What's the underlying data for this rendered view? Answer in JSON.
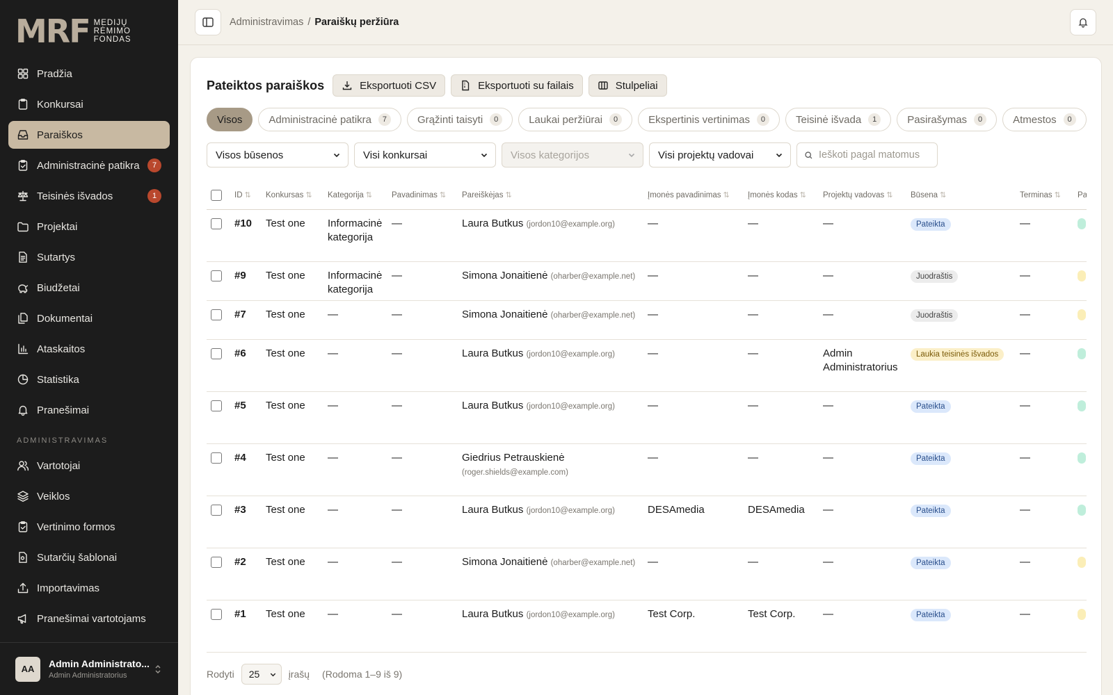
{
  "brand": {
    "mark": "MRF",
    "line1": "MEDIJŲ",
    "line2": "RĖMIMO",
    "line3": "FONDAS"
  },
  "nav": {
    "items": [
      {
        "label": "Pradžia",
        "icon": "dashboard-icon",
        "active": false
      },
      {
        "label": "Konkursai",
        "icon": "clipboard-icon",
        "active": false
      },
      {
        "label": "Paraiškos",
        "icon": "inbox-icon",
        "active": true
      },
      {
        "label": "Administracinė patikra",
        "icon": "clipboard-check-icon",
        "active": false,
        "count": "7"
      },
      {
        "label": "Teisinės išvados",
        "icon": "scale-icon",
        "active": false,
        "count": "1"
      },
      {
        "label": "Projektai",
        "icon": "folder-icon",
        "active": false
      },
      {
        "label": "Sutartys",
        "icon": "file-text-icon",
        "active": false
      },
      {
        "label": "Biudžetai",
        "icon": "piggy-bank-icon",
        "active": false
      },
      {
        "label": "Dokumentai",
        "icon": "files-icon",
        "active": false
      },
      {
        "label": "Ataskaitos",
        "icon": "bar-chart-icon",
        "active": false
      },
      {
        "label": "Statistika",
        "icon": "pie-chart-icon",
        "active": false
      },
      {
        "label": "Pranešimai",
        "icon": "bell-icon",
        "active": false
      }
    ],
    "section_label": "ADMINISTRAVIMAS",
    "admin_items": [
      {
        "label": "Vartotojai",
        "icon": "users-icon"
      },
      {
        "label": "Veiklos",
        "icon": "layers-icon"
      },
      {
        "label": "Vertinimo formos",
        "icon": "clipboard-check-icon"
      },
      {
        "label": "Sutarčių šablonai",
        "icon": "file-template-icon"
      },
      {
        "label": "Importavimas",
        "icon": "upload-icon"
      },
      {
        "label": "Pranešimai vartotojams",
        "icon": "megaphone-icon"
      }
    ]
  },
  "user": {
    "initials": "AA",
    "name": "Admin Administrato...",
    "role": "Admin Administratorius"
  },
  "breadcrumb": {
    "parent": "Administravimas",
    "separator": "/",
    "current": "Paraiškų peržiūra"
  },
  "card": {
    "title": "Pateiktos paraiškos",
    "export_csv": "Eksportuoti CSV",
    "export_files": "Eksportuoti su failais",
    "columns_btn": "Stulpeliai"
  },
  "tabs": [
    {
      "label": "Visos",
      "active": true
    },
    {
      "label": "Administracinė patikra",
      "count": "7"
    },
    {
      "label": "Grąžinti taisyti",
      "count": "0"
    },
    {
      "label": "Laukai peržiūrai",
      "count": "0"
    },
    {
      "label": "Ekspertinis vertinimas",
      "count": "0"
    },
    {
      "label": "Teisinė išvada",
      "count": "1"
    },
    {
      "label": "Pasirašymas",
      "count": "0"
    },
    {
      "label": "Atmestos",
      "count": "0"
    }
  ],
  "filters": {
    "status": "Visos būsenos",
    "contest": "Visi konkursai",
    "category": "Visos kategorijos",
    "manager": "Visi projektų vadovai",
    "search_placeholder": "Ieškoti pagal matomus"
  },
  "table": {
    "headers": [
      "ID",
      "Konkursas",
      "Kategorija",
      "Pavadinimas",
      "Pareiškėjas",
      "Įmonės pavadinimas",
      "Įmonės kodas",
      "Projektų vadovas",
      "Būsena",
      "Terminas",
      "Pa"
    ],
    "rows": [
      {
        "id": "#10",
        "contest": "Test one",
        "category": "Informacinė kategorija",
        "title": "—",
        "applicant": "Laura Butkus",
        "email": "(jordon10@example.org)",
        "company": "—",
        "code": "—",
        "manager": "—",
        "status": "Pateikta",
        "status_kind": "pateikta",
        "deadline": "—",
        "dot": "#bfeedb"
      },
      {
        "id": "#9",
        "contest": "Test one",
        "category": "Informacinė kategorija",
        "title": "—",
        "applicant": "Simona Jonaitienė",
        "email": "(oharber@example.net)",
        "company": "—",
        "code": "—",
        "manager": "—",
        "status": "Juodraštis",
        "status_kind": "juodrastis",
        "deadline": "—",
        "dot": "#fbeeb7"
      },
      {
        "id": "#7",
        "contest": "Test one",
        "category": "—",
        "title": "—",
        "applicant": "Simona Jonaitienė",
        "email": "(oharber@example.net)",
        "company": "—",
        "code": "—",
        "manager": "—",
        "status": "Juodraštis",
        "status_kind": "juodrastis",
        "deadline": "—",
        "dot": "#fbeeb7"
      },
      {
        "id": "#6",
        "contest": "Test one",
        "category": "—",
        "title": "—",
        "applicant": "Laura Butkus",
        "email": "(jordon10@example.org)",
        "company": "—",
        "code": "—",
        "manager": "Admin Administratorius",
        "status": "Laukia teisinės išvados",
        "status_kind": "laukia",
        "deadline": "—",
        "dot": "#bfeedb"
      },
      {
        "id": "#5",
        "contest": "Test one",
        "category": "—",
        "title": "—",
        "applicant": "Laura Butkus",
        "email": "(jordon10@example.org)",
        "company": "—",
        "code": "—",
        "manager": "—",
        "status": "Pateikta",
        "status_kind": "pateikta",
        "deadline": "—",
        "dot": "#bfeedb"
      },
      {
        "id": "#4",
        "contest": "Test one",
        "category": "—",
        "title": "—",
        "applicant": "Giedrius Petrauskienė",
        "email": "(roger.shields@example.com)",
        "company": "—",
        "code": "—",
        "manager": "—",
        "status": "Pateikta",
        "status_kind": "pateikta",
        "deadline": "—",
        "dot": "#bfeedb"
      },
      {
        "id": "#3",
        "contest": "Test one",
        "category": "—",
        "title": "—",
        "applicant": "Laura Butkus",
        "email": "(jordon10@example.org)",
        "company": "DESAmedia",
        "code": "DESAmedia",
        "manager": "—",
        "status": "Pateikta",
        "status_kind": "pateikta",
        "deadline": "—",
        "dot": "#bfeedb"
      },
      {
        "id": "#2",
        "contest": "Test one",
        "category": "—",
        "title": "—",
        "applicant": "Simona Jonaitienė",
        "email": "(oharber@example.net)",
        "company": "—",
        "code": "—",
        "manager": "—",
        "status": "Pateikta",
        "status_kind": "pateikta",
        "deadline": "—",
        "dot": "#fbeeb7"
      },
      {
        "id": "#1",
        "contest": "Test one",
        "category": "—",
        "title": "—",
        "applicant": "Laura Butkus",
        "email": "(jordon10@example.org)",
        "company": "Test Corp.",
        "code": "Test Corp.",
        "manager": "—",
        "status": "Pateikta",
        "status_kind": "pateikta",
        "deadline": "—",
        "dot": "#fbeeb7"
      }
    ]
  },
  "footer": {
    "show_label": "Rodyti",
    "page_size": "25",
    "records_label": "įrašų",
    "range": "(Rodoma 1–9 iš 9)"
  }
}
